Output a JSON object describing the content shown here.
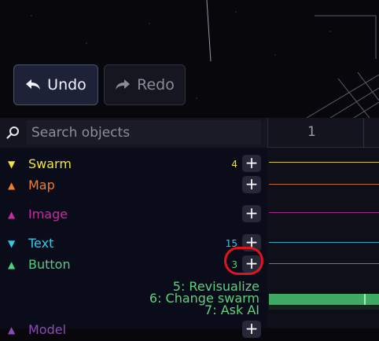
{
  "toolbar": {
    "undo_label": "Undo",
    "redo_label": "Redo"
  },
  "search": {
    "placeholder": "Search objects"
  },
  "objects": [
    {
      "label": "Swarm",
      "count": "4",
      "color": "#f2e23a"
    },
    {
      "label": "Map",
      "count": "",
      "color": "#f07d2a"
    },
    {
      "label": "Image",
      "count": "",
      "color": "#c42da0"
    },
    {
      "label": "Text",
      "count": "15",
      "color": "#3bc6e0"
    },
    {
      "label": "Button",
      "count": "3",
      "color": "#4fd07a"
    },
    {
      "label": "Model",
      "count": "",
      "color": "#8e4ac0"
    }
  ],
  "hints": [
    "5: Revisualize",
    "6: Change swarm",
    "7: Ask AI"
  ],
  "timeline": {
    "frame_number": "1"
  },
  "colors": {
    "hint_text": "#5fd17f",
    "annotation": "#e0141d",
    "bar": "#3eaa62"
  }
}
